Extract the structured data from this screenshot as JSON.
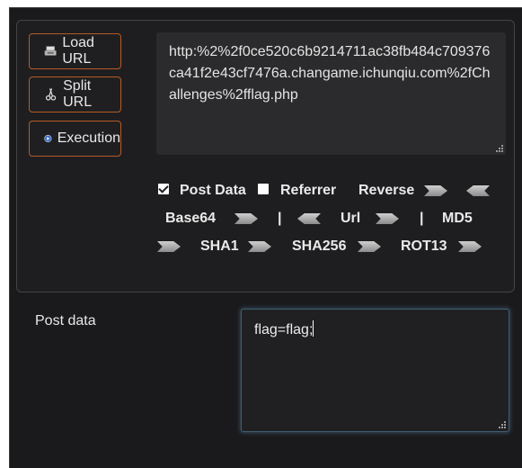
{
  "buttons": {
    "load_url": "Load URL",
    "split_url": "Split URL",
    "execution": "Execution"
  },
  "url": {
    "value": "http:%2%2f0ce520c6b9214711ac38fb484c709376ca41f2e43cf7476a.changame.ichunqiu.com%2fChallenges%2fflag.php"
  },
  "options": {
    "post_data": "Post Data",
    "post_data_checked": true,
    "referrer": "Referrer",
    "referrer_checked": false,
    "reverse": "Reverse",
    "base64": "Base64",
    "sep1": "|",
    "url": "Url",
    "sep2": "|",
    "md5": "MD5",
    "sha1": "SHA1",
    "sha256": "SHA256",
    "rot13": "ROT13"
  },
  "post": {
    "label": "Post data",
    "value": "flag=flag;"
  },
  "colors": {
    "button_border": "#b65b24",
    "panel_bg": "#1a1a1c",
    "focus_glow": "#6eaad2"
  }
}
